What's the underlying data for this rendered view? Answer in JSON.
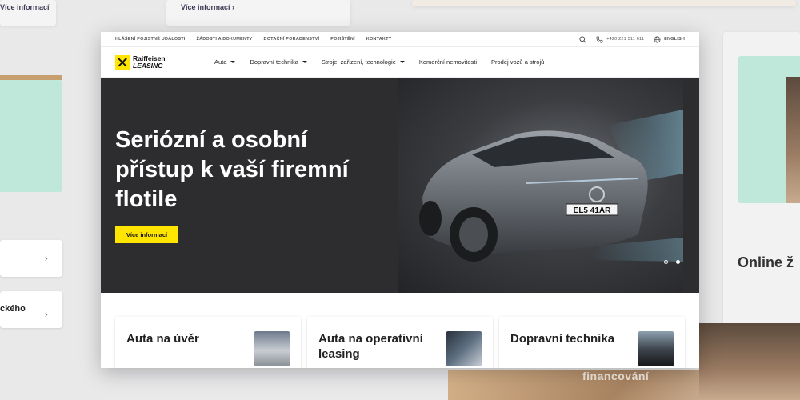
{
  "background": {
    "top_links": [
      "Více informací",
      "Více informací"
    ],
    "side_text_left": "ckého",
    "side_heading_right": "Online ž",
    "photo_caption": "financování"
  },
  "topbar": {
    "links": [
      "HLÁŠENÍ POJISTNÉ UDÁLOSTI",
      "ŽÁDOSTI A DOKUMENTY",
      "DOTAČNÍ PORADENSTVÍ",
      "POJIŠTĚNÍ",
      "KONTAKTY"
    ],
    "phone": "+420 221 511 611",
    "language": "ENGLISH"
  },
  "navbar": {
    "logo_line1": "Raiffeisen",
    "logo_line2": "LEASING",
    "menu": [
      {
        "label": "Auta",
        "dropdown": true
      },
      {
        "label": "Dopravní technika",
        "dropdown": true
      },
      {
        "label": "Stroje, zařízení, technologie",
        "dropdown": true
      },
      {
        "label": "Komerční nemovitosti",
        "dropdown": false
      },
      {
        "label": "Prodej vozů a strojů",
        "dropdown": false
      }
    ]
  },
  "hero": {
    "title": "Seriózní a osobní přístup k vaší firemní flotile",
    "button": "Více informací",
    "plate": "EL5 41AR",
    "slides": 2,
    "active_slide": 2
  },
  "cards": [
    {
      "title": "Auta na úvěr"
    },
    {
      "title": "Auta na operativní leasing"
    },
    {
      "title": "Dopravní technika"
    }
  ],
  "colors": {
    "brand_yellow": "#ffe500",
    "hero_bg": "#2d2d30",
    "mint": "#bfe8da"
  }
}
